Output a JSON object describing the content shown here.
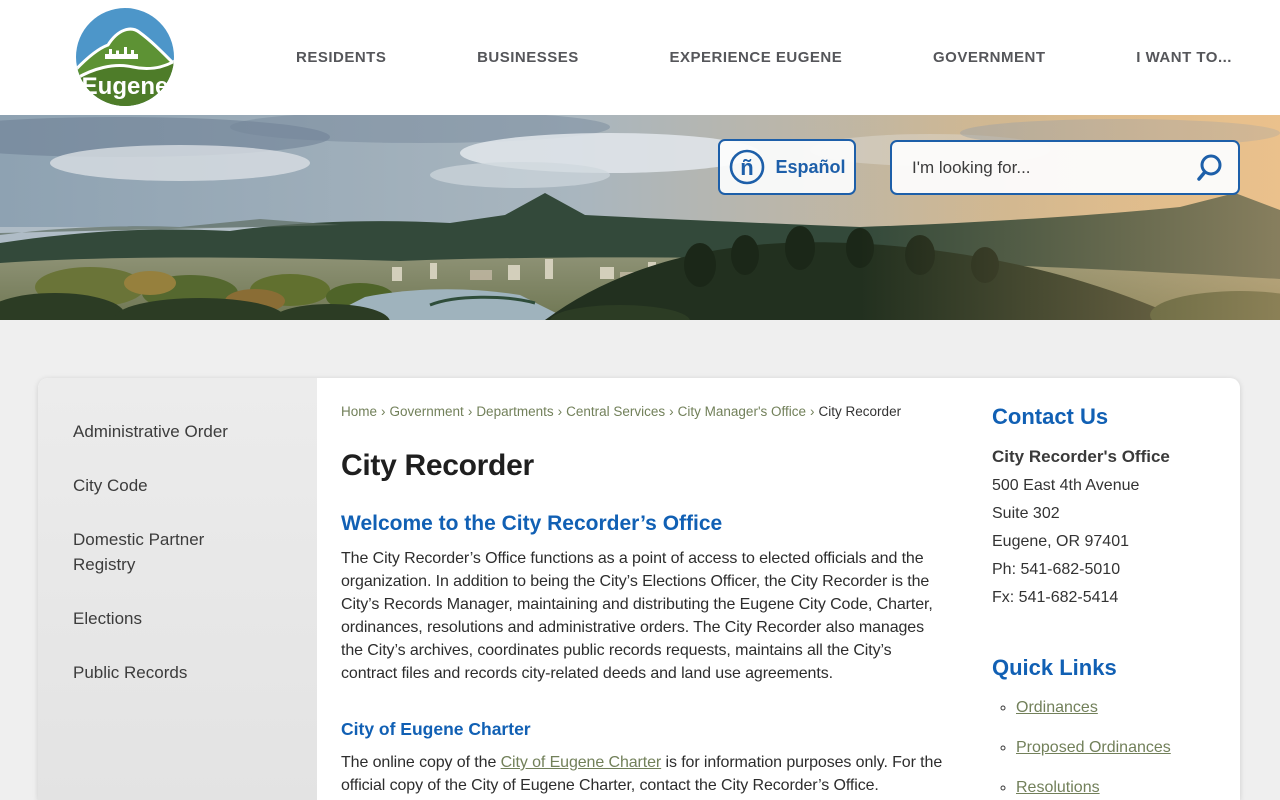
{
  "colors": {
    "accent_blue": "#1160b4",
    "border_blue": "#1d5fa9",
    "link_olive": "#72805a",
    "nav_text": "#55565a",
    "logo_blue": "#4d96c9",
    "logo_green": "#5d9234"
  },
  "logo": {
    "text": "Eugene"
  },
  "nav": {
    "items": [
      "RESIDENTS",
      "BUSINESSES",
      "EXPERIENCE EUGENE",
      "GOVERNMENT",
      "I WANT TO..."
    ]
  },
  "hero": {
    "espanol_label": "Español",
    "espanol_icon": "n-tilde-circle-icon",
    "search_placeholder": "I'm looking for...",
    "search_icon": "magnifier-icon"
  },
  "sidebar": {
    "items": [
      "Administrative Order",
      "City Code",
      "Domestic Partner Registry",
      "Elections",
      "Public Records"
    ]
  },
  "breadcrumb": {
    "separator": "›",
    "links": [
      "Home",
      "Government",
      "Departments",
      "Central Services",
      "City Manager's Office"
    ],
    "current": "City Recorder"
  },
  "main": {
    "title": "City Recorder",
    "welcome_heading": "Welcome to the City Recorder’s Office",
    "welcome_body": "The City Recorder’s Office functions as a point of access to elected officials and the organization. In addition to being the City’s Elections Officer, the City Recorder is the City’s Records Manager, maintaining and distributing the Eugene City Code, Charter, ordinances, resolutions and administrative orders. The City Recorder also manages the City’s archives, coordinates public records requests, maintains all the City’s contract files and records city-related deeds and land use agreements.",
    "charter_heading": "City of Eugene Charter",
    "charter_before": "The online copy of the ",
    "charter_link": "City of Eugene Charter",
    "charter_after": " is for information purposes only. For the official copy of the City of Eugene Charter, contact the City Recorder’s Office."
  },
  "contact": {
    "heading": "Contact Us",
    "office": "City Recorder's Office",
    "address_line1": "500 East 4th Avenue",
    "address_line2": "Suite 302",
    "address_line3": "Eugene, OR 97401",
    "phone": "Ph: 541-682-5010",
    "fax": "Fx: 541-682-5414"
  },
  "quick_links": {
    "heading": "Quick Links",
    "links": [
      "Ordinances",
      "Proposed Ordinances",
      "Resolutions"
    ]
  }
}
